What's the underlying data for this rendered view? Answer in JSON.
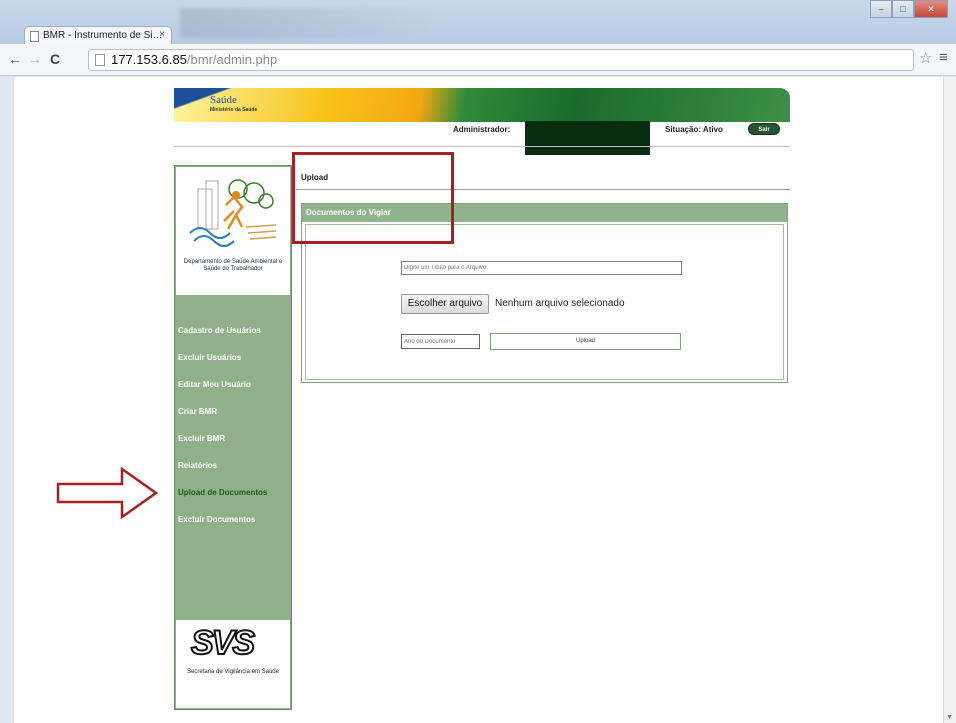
{
  "browser": {
    "tab_title": "BMR - Instrumento de Si…",
    "tab_close": "×",
    "url_host": "177.153.6.85",
    "url_path": "/bmr/admin.php",
    "back_icon": "←",
    "forward_icon": "→",
    "reload_icon": "C",
    "star_icon": "☆",
    "menu_icon": "≡"
  },
  "site": {
    "logo_title": "Saúde",
    "logo_subtitle": "Ministério da Saúde",
    "admin_label": "Administrador:",
    "status_label": "Situação: Ativo",
    "logout_button": "Sair"
  },
  "sidebar": {
    "department": "Departamento de Saúde Ambiental e Saúde do Trabalhador",
    "items": [
      {
        "label": "Cadastro de Usuários"
      },
      {
        "label": "Excluir Usuários"
      },
      {
        "label": "Editar Meu Usuário"
      },
      {
        "label": "Criar BMR"
      },
      {
        "label": "Excluir BMR"
      },
      {
        "label": "Relatórios"
      },
      {
        "label": "Upload de Documentos"
      },
      {
        "label": "Excluir Documentos"
      }
    ],
    "svs_logo": "SVS",
    "svs_label": "Secretaria de Vigilância em Saúde"
  },
  "main": {
    "breadcrumb": "Upload",
    "panel_title": "Documentos do Vigiar",
    "title_input_placeholder": "Digite um Título para o Arquivo",
    "choose_file_button": "Escolher arquivo",
    "file_status": "Nenhum arquivo selecionado",
    "year_input_placeholder": "Ano do Documento",
    "upload_button": "Upload"
  },
  "colors": {
    "sidebar_green": "#8fb089",
    "highlight_red": "#a82024"
  }
}
